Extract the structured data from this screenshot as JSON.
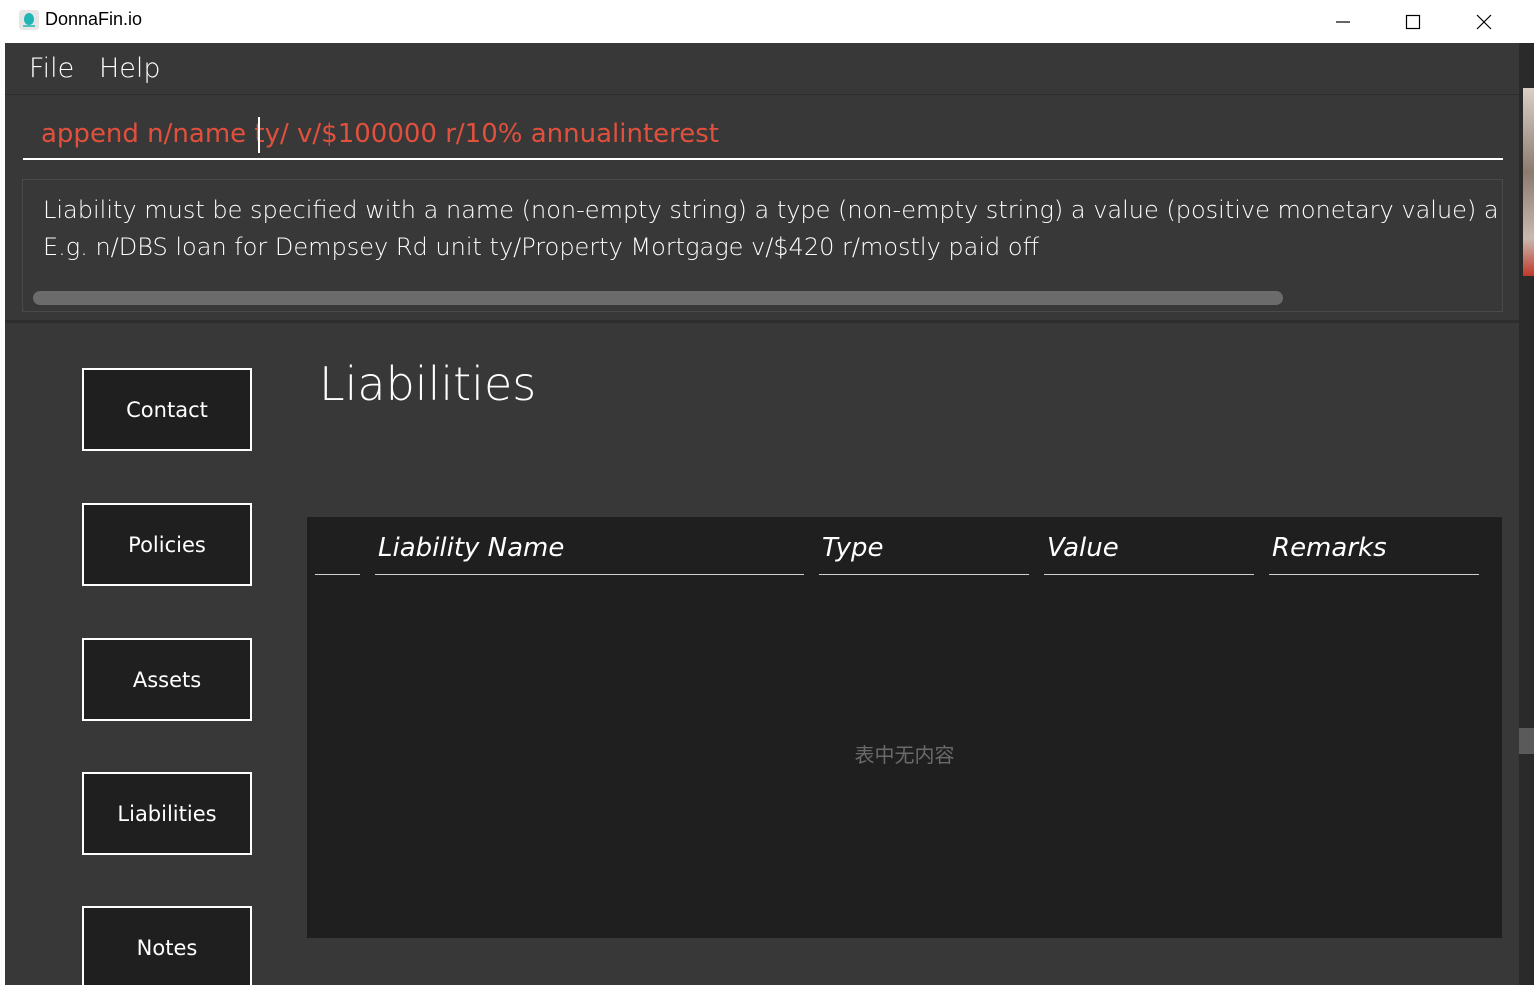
{
  "window": {
    "title": "DonnaFin.io"
  },
  "menu": {
    "file": "File",
    "help": "Help"
  },
  "command": {
    "value": "append n/name ty/ v/$100000 r/10% annualinterest"
  },
  "result": {
    "line1": "Liability must be specified with a name (non-empty string) a type (non-empty string) a value (positive monetary value) a remark",
    "line2": "E.g. n/DBS loan for Dempsey Rd unit ty/Property Mortgage v/$420 r/mostly paid off"
  },
  "tabs": [
    {
      "label": "Contact"
    },
    {
      "label": "Policies"
    },
    {
      "label": "Assets"
    },
    {
      "label": "Liabilities"
    },
    {
      "label": "Notes"
    }
  ],
  "section": {
    "title": "Liabilities"
  },
  "table": {
    "columns": [
      "",
      "Liability Name",
      "Type",
      "Value",
      "Remarks"
    ],
    "rows": [],
    "empty_message": "表中无内容"
  },
  "colors": {
    "command_text": "#e1503d",
    "background": "#383838",
    "panel": "#1f1f1f",
    "accent_icon": "#20b6b6"
  },
  "icons": {
    "app": "donnafin-app-icon",
    "minimize": "minimize-icon",
    "maximize": "maximize-icon",
    "close": "close-icon"
  }
}
